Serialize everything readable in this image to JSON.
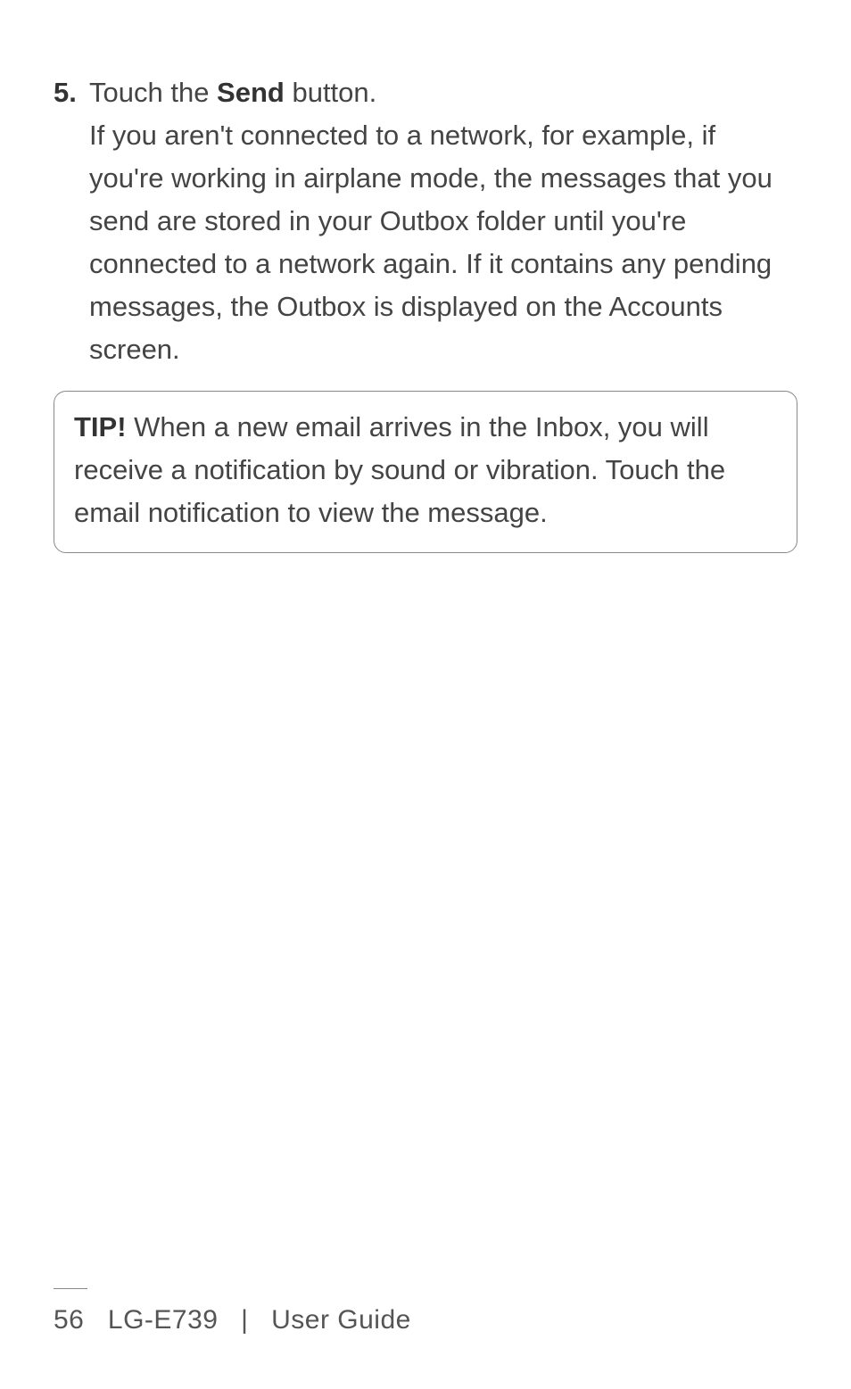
{
  "step": {
    "number": "5.",
    "line1_prefix": "Touch the ",
    "line1_bold": "Send",
    "line1_suffix": " button.",
    "paragraph": "If you aren't connected to a network, for example, if you're working in airplane mode, the messages that you send are stored in your Outbox folder until you're connected to a network again. If it contains any pending messages, the Outbox is displayed on the Accounts screen."
  },
  "tip": {
    "label": "TIP!",
    "text": " When a new email arrives in the Inbox, you will receive a notification by sound or vibration. Touch the email notification to view the message."
  },
  "footer": {
    "page": "56",
    "model": "LG-E739",
    "divider": "|",
    "title": "User Guide"
  }
}
